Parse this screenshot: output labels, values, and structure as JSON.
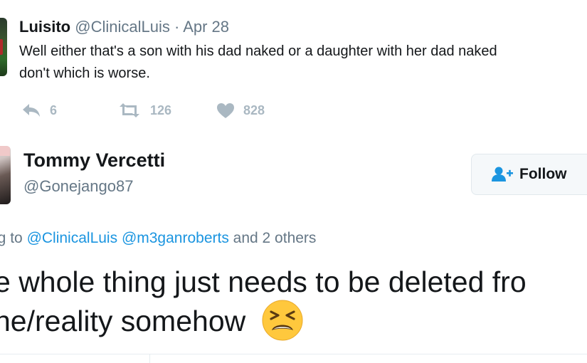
{
  "reply_tweet": {
    "author_name": "Luisito",
    "author_handle": "@ClinicalLuis",
    "separator": "·",
    "date": "Apr 28",
    "text_line1": "Well either that's a son with his dad naked or a daughter with her dad naked",
    "text_line2": "don't which is worse.",
    "actions": {
      "reply_icon": "reply-arrow-icon",
      "reply_count": "6",
      "retweet_icon": "retweet-icon",
      "retweet_count": "126",
      "like_icon": "heart-icon",
      "like_count": "828"
    }
  },
  "main_tweet": {
    "author_name": "Tommy Vercetti",
    "author_handle": "@Gonejango87",
    "follow_button": {
      "icon": "add-user-icon",
      "label": "Follow"
    },
    "replying_prefix": "ng to",
    "replying_mentions": [
      "@ClinicalLuis",
      "@m3ganroberts"
    ],
    "replying_suffix": "and 2 others",
    "text_line1": "e whole thing just needs to be deleted fro",
    "text_line2": "he/reality somehow",
    "emoji": "tired-face-emoji"
  },
  "colors": {
    "text": "#14171a",
    "secondary": "#657786",
    "link": "#1b95e0",
    "action_gray": "#aab8c2",
    "follow_icon_blue": "#1b95e0",
    "emoji_yellow": "#ffc83d"
  }
}
